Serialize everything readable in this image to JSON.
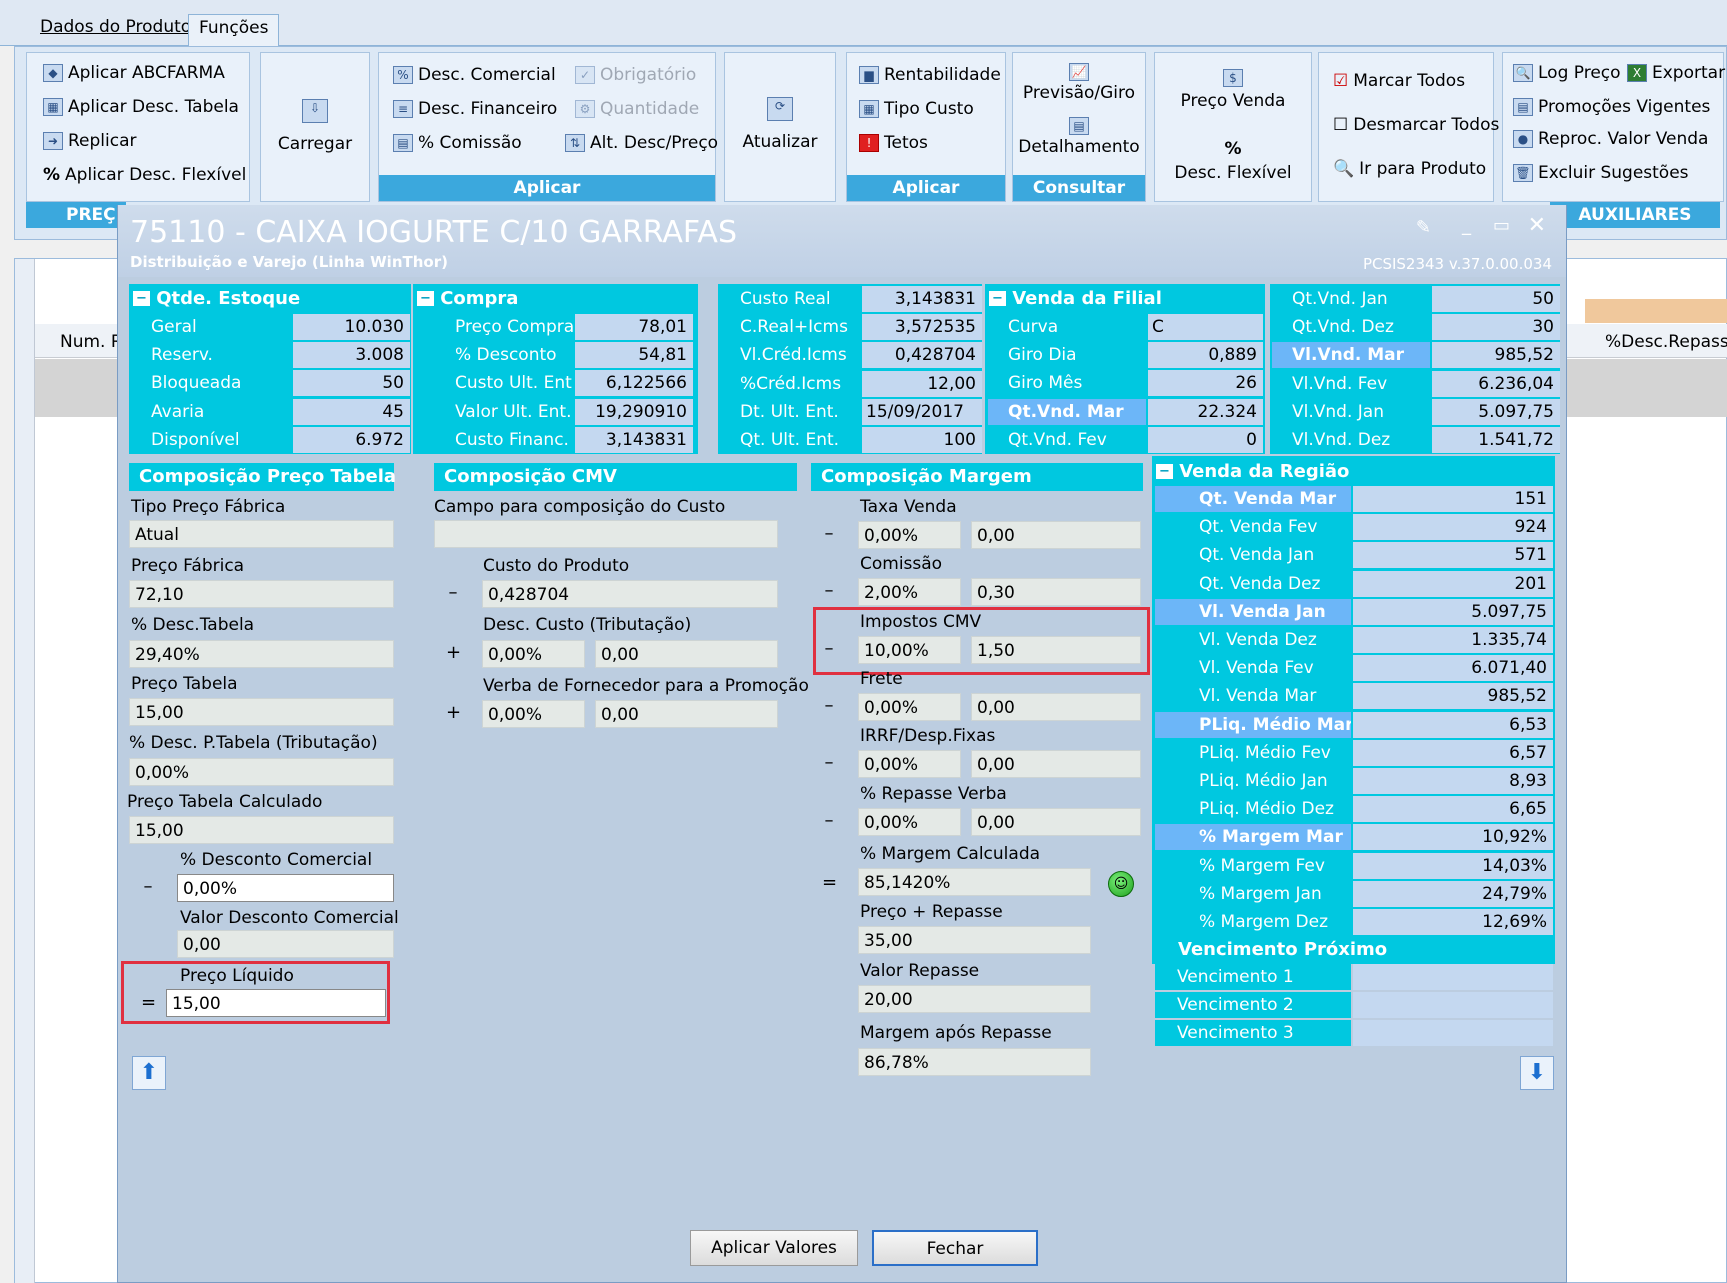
{
  "tabs": [
    "Dados do Produto",
    "Funções"
  ],
  "ribbon": {
    "g1": [
      "Aplicar ABCFARMA",
      "Aplicar Desc. Tabela",
      "Replicar",
      "Aplicar Desc. Flexível"
    ],
    "g1_footer": "PREÇ",
    "carregar": "Carregar",
    "aplicar": [
      "Desc. Comercial",
      "Desc. Financeiro",
      "% Comissão"
    ],
    "aplicar_dis": [
      "Obrigatório",
      "Quantidade"
    ],
    "alt": "Alt. Desc/Preço",
    "aplicar_footer": "Aplicar",
    "atualizar": "Atualizar",
    "aplicar2": [
      "Rentabilidade",
      "Tipo Custo",
      "Tetos"
    ],
    "aplicar2_footer": "Aplicar",
    "consultar": [
      "Previsão/Giro",
      "Detalhamento"
    ],
    "consultar_footer": "Consultar",
    "preco_venda": "Preço Venda",
    "desc_flexivel": "Desc. Flexível",
    "marcar": [
      "Marcar Todos",
      "Desmarcar Todos",
      "Ir para Produto"
    ],
    "aux": [
      "Log Preço",
      "Exportar",
      "Promoções Vigentes",
      "Reproc. Valor Venda",
      "Excluir Sugestões"
    ],
    "aux_footer": "AUXILIARES"
  },
  "grid": {
    "col1": "Num. Reg",
    "col2": "%Desc.Repasse"
  },
  "dialog": {
    "title": "75110 - CAIXA IOGURTE C/10 GARRAFAS",
    "subtitle": "Distribuição e Varejo (Linha WinThor)",
    "version": "PCSIS2343  v.37.0.00.034"
  },
  "estoque": {
    "header": "Qtde. Estoque",
    "rows": [
      [
        "Geral",
        "10.030"
      ],
      [
        "Reserv.",
        "3.008"
      ],
      [
        "Bloqueada",
        "50"
      ],
      [
        "Avaria",
        "45"
      ],
      [
        "Disponível",
        "6.972"
      ]
    ]
  },
  "compra": {
    "header": "Compra",
    "rows": [
      [
        "Preço Compra",
        "78,01"
      ],
      [
        "% Desconto",
        "54,81"
      ],
      [
        "Custo Ult. Ent",
        "6,122566"
      ],
      [
        "Valor Ult. Ent.",
        "19,290910"
      ],
      [
        "Custo Financ.",
        "3,143831"
      ]
    ]
  },
  "custo": {
    "rows": [
      [
        "Custo Real",
        "3,143831"
      ],
      [
        "C.Real+Icms",
        "3,572535"
      ],
      [
        "Vl.Créd.Icms",
        "0,428704"
      ],
      [
        "%Créd.Icms",
        "12,00"
      ],
      [
        "Dt. Ult. Ent.",
        "15/09/2017"
      ],
      [
        "Qt. Ult. Ent.",
        "100"
      ]
    ]
  },
  "filial": {
    "header": "Venda da Filial",
    "rows": [
      [
        "Curva",
        "C"
      ],
      [
        "Giro Dia",
        "0,889"
      ],
      [
        "Giro Mês",
        "26"
      ],
      [
        "Qt.Vnd. Mar",
        "22.324"
      ],
      [
        "Qt.Vnd. Fev",
        "0"
      ]
    ]
  },
  "vnd": {
    "rows": [
      [
        "Qt.Vnd. Jan",
        "50"
      ],
      [
        "Qt.Vnd. Dez",
        "30"
      ],
      [
        "Vl.Vnd. Mar",
        "985,52"
      ],
      [
        "Vl.Vnd. Fev",
        "6.236,04"
      ],
      [
        "Vl.Vnd. Jan",
        "5.097,75"
      ],
      [
        "Vl.Vnd. Dez",
        "1.541,72"
      ]
    ]
  },
  "cpt": {
    "header": "Composição Preço Tabela",
    "tipo_lbl": "Tipo Preço Fábrica",
    "tipo": "Atual",
    "pf_lbl": "Preço Fábrica",
    "pf": "72,10",
    "dt_lbl": "% Desc.Tabela",
    "dt": "29,40%",
    "pt_lbl": "Preço Tabela",
    "pt": "15,00",
    "dpt_lbl": "% Desc. P.Tabela (Tributação)",
    "dpt": "0,00%",
    "ptc_lbl": "Preço Tabela Calculado",
    "ptc": "15,00",
    "dc_lbl": "% Desconto Comercial",
    "dc": "0,00%",
    "vdc_lbl": "Valor Desconto Comercial",
    "vdc": "0,00",
    "pl_lbl": "Preço Líquido",
    "pl": "15,00"
  },
  "cmv": {
    "header": "Composição CMV",
    "campo_lbl": "Campo para composição do Custo",
    "campo": "",
    "cp_lbl": "Custo do Produto",
    "cp": "0,428704",
    "dct_lbl": "Desc. Custo (Tributação)",
    "dct1": "0,00%",
    "dct2": "0,00",
    "vf_lbl": "Verba de Fornecedor para a Promoção",
    "vf1": "0,00%",
    "vf2": "0,00"
  },
  "margem": {
    "header": "Composição Margem",
    "rows": [
      [
        "Taxa Venda",
        "0,00%",
        "0,00"
      ],
      [
        "Comissão",
        "2,00%",
        "0,30"
      ],
      [
        "Impostos CMV",
        "10,00%",
        "1,50"
      ],
      [
        "Frete",
        "0,00%",
        "0,00"
      ],
      [
        "IRRF/Desp.Fixas",
        "0,00%",
        "0,00"
      ],
      [
        "% Repasse Verba",
        "0,00%",
        "0,00"
      ]
    ],
    "mc_lbl": "% Margem Calculada",
    "mc": "85,1420%",
    "pr_lbl": "Preço + Repasse",
    "pr": "35,00",
    "vr_lbl": "Valor Repasse",
    "vr": "20,00",
    "mar_lbl": "Margem após Repasse",
    "mar": "86,78%"
  },
  "regiao": {
    "header": "Venda da Região",
    "rows": [
      [
        "Qt. Venda Mar",
        "151"
      ],
      [
        "Qt. Venda Fev",
        "924"
      ],
      [
        "Qt. Venda Jan",
        "571"
      ],
      [
        "Qt. Venda Dez",
        "201"
      ],
      [
        "Vl. Venda Jan",
        "5.097,75"
      ],
      [
        "Vl. Venda Dez",
        "1.335,74"
      ],
      [
        "Vl. Venda Fev",
        "6.071,40"
      ],
      [
        "Vl. Venda Mar",
        "985,52"
      ],
      [
        "PLiq. Médio Mar",
        "6,53"
      ],
      [
        "PLiq. Médio Fev",
        "6,57"
      ],
      [
        "PLiq. Médio Jan",
        "8,93"
      ],
      [
        "PLiq. Médio Dez",
        "6,65"
      ],
      [
        "% Margem Mar",
        "10,92%"
      ],
      [
        "% Margem Fev",
        "14,03%"
      ],
      [
        "% Margem Jan",
        "24,79%"
      ],
      [
        "% Margem Dez",
        "12,69%"
      ]
    ]
  },
  "venc": {
    "header": "Vencimento Próximo",
    "rows": [
      "Vencimento 1",
      "Vencimento 2",
      "Vencimento 3"
    ]
  },
  "buttons": {
    "aplicar": "Aplicar Valores",
    "fechar": "Fechar"
  },
  "ops": {
    "minus": "–",
    "plus": "+",
    "eq": "="
  }
}
